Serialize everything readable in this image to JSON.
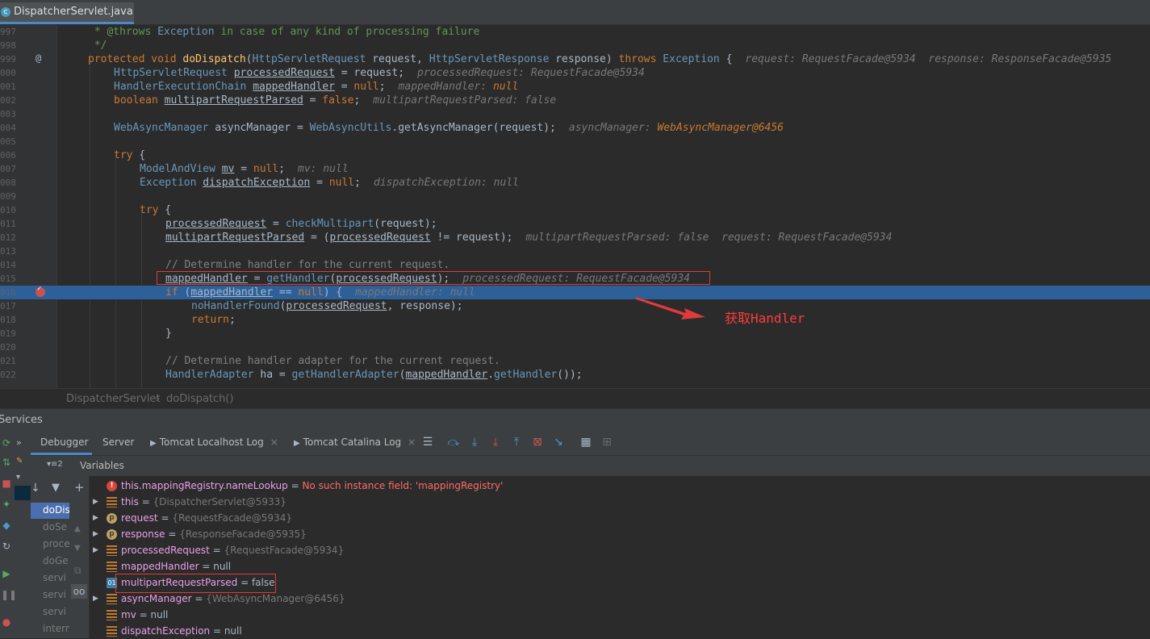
{
  "editor_tab": {
    "filename": "DispatcherServlet.java",
    "icon": "c"
  },
  "code_lines": [
    {
      "num": "997"
    },
    {
      "num": "998"
    },
    {
      "num": "999"
    },
    {
      "num": "000"
    },
    {
      "num": "001"
    },
    {
      "num": "002"
    },
    {
      "num": "003"
    },
    {
      "num": "004"
    },
    {
      "num": "005"
    },
    {
      "num": "006"
    },
    {
      "num": "007"
    },
    {
      "num": "008"
    },
    {
      "num": "009"
    },
    {
      "num": "010"
    },
    {
      "num": "011"
    },
    {
      "num": "012"
    },
    {
      "num": "013"
    },
    {
      "num": "014"
    },
    {
      "num": "015"
    },
    {
      "num": "016"
    },
    {
      "num": "017"
    },
    {
      "num": "018"
    },
    {
      "num": "019"
    },
    {
      "num": "020"
    },
    {
      "num": "021"
    },
    {
      "num": "022"
    }
  ],
  "gutter": {
    "override_marker": "@"
  },
  "code": {
    "l997": {
      "star": " * ",
      "tag": "@throws",
      "type": " Exception",
      "rest": " in case of any kind of processing failure"
    },
    "l998": " */",
    "l999": {
      "kw": "protected void ",
      "name": "doDispatch",
      "p1": "(",
      "t1": "HttpServletRequest",
      "v1": " request, ",
      "t2": "HttpServletResponse",
      "v2": " response) ",
      "kw2": "throws ",
      "t3": "Exception",
      "br": " {",
      "hint": "request: RequestFacade@5934  response: ResponseFacade@5935"
    },
    "l000": {
      "type": "HttpServletRequest ",
      "var": "processedRequest",
      "rest": " = request;",
      "hint": "processedRequest: RequestFacade@5934"
    },
    "l001": {
      "type": "HandlerExecutionChain ",
      "var": "mappedHandler",
      "rest": " = ",
      "kw": "null",
      "semi": ";",
      "hint": "mappedHandler: ",
      "hint_kw": "null"
    },
    "l002": {
      "kw": "boolean ",
      "var": "multipartRequestParsed",
      "rest": " = ",
      "kw2": "false",
      "semi": ";",
      "hint": "multipartRequestParsed: false"
    },
    "l004": {
      "type": "WebAsyncManager",
      "rest": " asyncManager = ",
      "type2": "WebAsyncUtils",
      "rest2": ".getAsyncManager(request);",
      "hint": "asyncManager: ",
      "hint_obj": "WebAsyncManager@6456"
    },
    "l006": {
      "kw": "try",
      "rest": " {"
    },
    "l007": {
      "type": "ModelAndView ",
      "var": "mv",
      "rest": " = ",
      "kw": "null",
      "semi": ";",
      "hint": "mv: null"
    },
    "l008": {
      "type": "Exception ",
      "var": "dispatchException",
      "rest": " = ",
      "kw": "null",
      "semi": ";",
      "hint": "dispatchException: null"
    },
    "l010": {
      "kw": "try",
      "rest": " {"
    },
    "l011": {
      "var": "processedRequest",
      "rest": " = ",
      "fn": "checkMultipart",
      "rest2": "(request);"
    },
    "l012": {
      "var": "multipartRequestParsed",
      "rest": " = (",
      "var2": "processedRequest",
      "rest2": " != request);",
      "hint": "multipartRequestParsed: false  request: RequestFacade@5934"
    },
    "l014": "// Determine handler for the current request.",
    "l015": {
      "var": "mappedHandler",
      "rest": " = ",
      "fn": "getHandler",
      "p": "(",
      "var2": "processedRequest",
      "rest2": ");",
      "hint": "processedRequest: RequestFacade@5934"
    },
    "l016": {
      "kw": "if",
      "rest": " (",
      "var": "mappedHandler",
      "rest2": " == ",
      "kw2": "null",
      "rest3": ") {",
      "hint": "mappedHandler: null"
    },
    "l017": {
      "fn": "noHandlerFound",
      "p": "(",
      "var": "processedRequest",
      "rest": ", response);"
    },
    "l018": {
      "kw": "return",
      "rest": ";"
    },
    "l019": "}",
    "l021": "// Determine handler adapter for the current request.",
    "l022": {
      "type": "HandlerAdapter",
      "rest": " ha = ",
      "fn": "getHandlerAdapter",
      "p": "(",
      "var": "mappedHandler",
      "rest2": ".",
      "fn2": "getHandler",
      "rest3": "());"
    }
  },
  "annotation": {
    "text": "获取Handler",
    "color": "#ff3b3b"
  },
  "breadcrumb": {
    "class": "DispatcherServlet",
    "sep": "›",
    "method": "doDispatch()"
  },
  "services": {
    "title": "Services"
  },
  "debug_tabs": [
    {
      "label": "Debugger"
    },
    {
      "label": "Server"
    },
    {
      "label": "Tomcat Localhost Log",
      "close": "×"
    },
    {
      "label": "Tomcat Catalina Log",
      "close": "×"
    }
  ],
  "frames_header": {
    "label": "▾≡2"
  },
  "frames": [
    {
      "label": "doDis"
    },
    {
      "label": "doSe"
    },
    {
      "label": "proce"
    },
    {
      "label": "doGe"
    },
    {
      "label": "servi"
    },
    {
      "label": "servi"
    },
    {
      "label": "servi"
    },
    {
      "label": "intern"
    }
  ],
  "variables": {
    "title": "Variables",
    "rows": [
      {
        "icon": "error",
        "expand": "",
        "name": "this.mappingRegistry.nameLookup",
        "eq": " = ",
        "value": "No such instance field: 'mappingRegistry'",
        "kind": "err"
      },
      {
        "icon": "field",
        "expand": "▶",
        "name": "this",
        "eq": " = ",
        "value": "{DispatcherServlet@5933}",
        "kind": "obj"
      },
      {
        "icon": "param",
        "expand": "▶",
        "name": "request",
        "eq": " = ",
        "value": "{RequestFacade@5934}",
        "kind": "obj"
      },
      {
        "icon": "param",
        "expand": "▶",
        "name": "response",
        "eq": " = ",
        "value": "{ResponseFacade@5935}",
        "kind": "obj"
      },
      {
        "icon": "field",
        "expand": "▶",
        "name": "processedRequest",
        "eq": " = ",
        "value": "{RequestFacade@5934}",
        "kind": "obj"
      },
      {
        "icon": "field",
        "expand": "",
        "name": "mappedHandler",
        "eq": " = ",
        "value": "null",
        "kind": "val"
      },
      {
        "icon": "bool",
        "expand": "",
        "name": "multipartRequestParsed",
        "eq": " = ",
        "value": "false",
        "kind": "val"
      },
      {
        "icon": "field",
        "expand": "▶",
        "name": "asyncManager",
        "eq": " = ",
        "value": "{WebAsyncManager@6456}",
        "kind": "obj"
      },
      {
        "icon": "field",
        "expand": "",
        "name": "mv",
        "eq": " = ",
        "value": "null",
        "kind": "val"
      },
      {
        "icon": "field",
        "expand": "",
        "name": "dispatchException",
        "eq": " = ",
        "value": "null",
        "kind": "val"
      }
    ]
  },
  "colors": {
    "highlight_line": "#2d6099",
    "annotation_box": "#e03a3a"
  }
}
